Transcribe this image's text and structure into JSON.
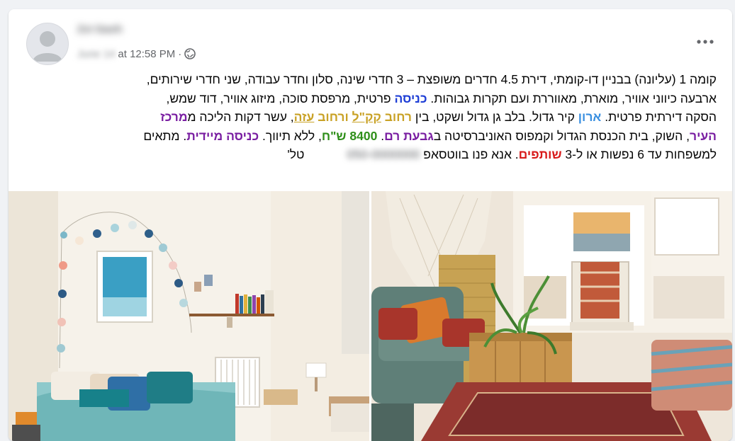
{
  "post": {
    "author_name": "Zvi Gavh",
    "date_blurred": "June 14",
    "time": "at 12:58 PM",
    "separator": "·",
    "privacy_icon": "globe-icon",
    "more_icon": "more-options-icon"
  },
  "text": {
    "l1": "קומה 1 (עליונה) בבניין דו-קומתי, דירת 4.5 חדרים משופצת – 3 חדרי שינה, סלון וחדר עבודה, שני חדרי שירותים,",
    "l2_a": "ארבעה כיווני אוויר, מוארת, מאווררת ועם תקרות גבוהות. ",
    "l2_b": "כניסה",
    "l2_c": " פרטית, מרפסת סוכה, מיזוג אוויר, דוד שמש,",
    "l3_a": "הסקה דירתית פרטית. ",
    "l3_b": "ארון",
    "l3_c": " קיר גדול.  בלב גן גדול ושקט, בין ",
    "l3_d": "רחוב ",
    "l3_e": "קק\"ל",
    "l3_f": " ורחוב ",
    "l3_g": "עזה",
    "l3_h": ", עשר דקות הליכה מ",
    "l3_i": "מרכז",
    "l4_a": "העיר",
    "l4_b": ", השוק, בית הכנסת הגדול וקמפוס האוניברסיטה ב",
    "l4_c": "גבעת רם",
    "l4_d": ". ",
    "l4_e": "8400 ש\"ח",
    "l4_f": ", ללא תיווך. ",
    "l4_g": "כניסה מיידית",
    "l4_h": ". מתאים",
    "l5_a": "למשפחות עד 6 נפשות או ל-3 ",
    "l5_b": "שותפים",
    "l5_c": ". אנא פנו בווטסאפ ",
    "l5_phone": "050-0000000",
    "l5_d": " טל'"
  },
  "photos": {
    "left_desc": "bedroom-photo",
    "right_desc": "living-room-photo"
  },
  "colors": {
    "blue": "#1f3fd6",
    "lightblue": "#3a8fe0",
    "gold": "#c9a227",
    "purple": "#7a1fa2",
    "green": "#2f8f1a",
    "red": "#d81b1b"
  }
}
